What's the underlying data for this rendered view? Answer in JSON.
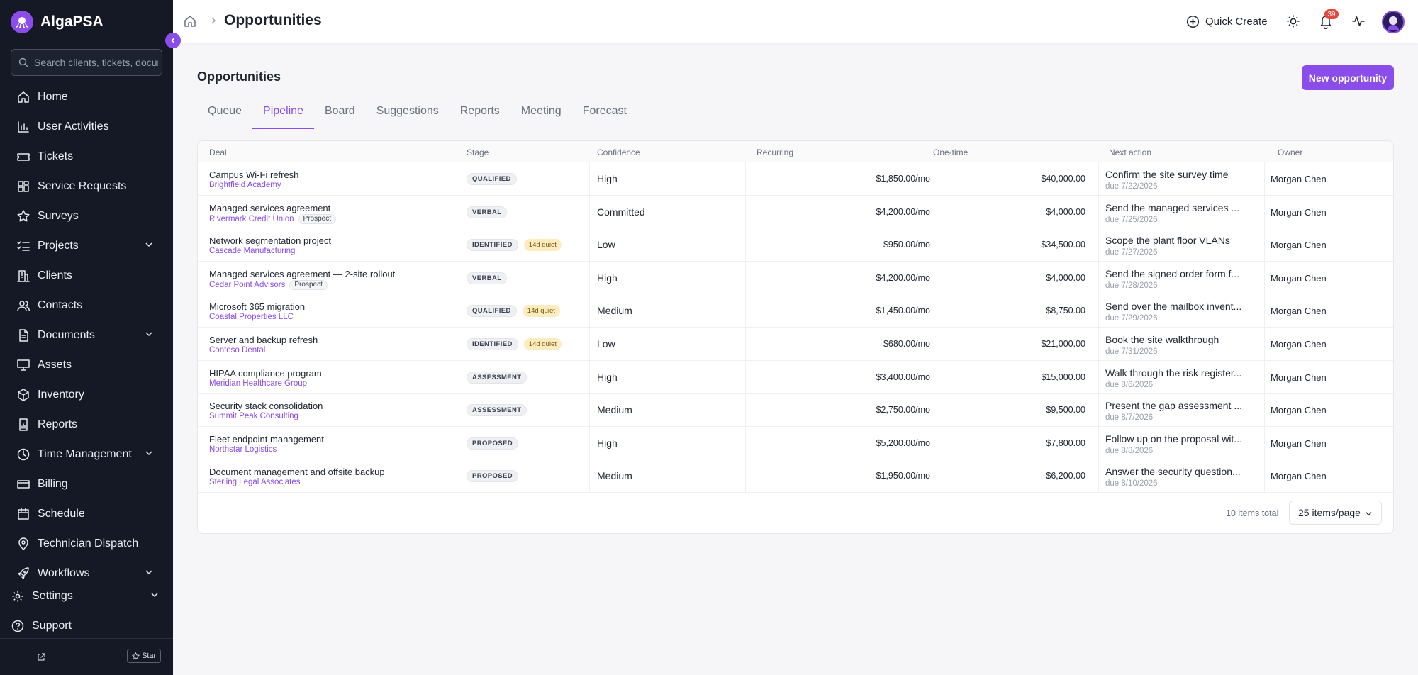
{
  "app": {
    "name": "AlgaPSA"
  },
  "sidebar": {
    "search_placeholder": "Search clients, tickets, documents",
    "items": [
      {
        "label": "Home",
        "icon": "home-icon",
        "expandable": false
      },
      {
        "label": "User Activities",
        "icon": "bar-chart-icon",
        "expandable": false
      },
      {
        "label": "Tickets",
        "icon": "ticket-icon",
        "expandable": false
      },
      {
        "label": "Service Requests",
        "icon": "layout-icon",
        "expandable": false
      },
      {
        "label": "Surveys",
        "icon": "star-icon",
        "expandable": false
      },
      {
        "label": "Projects",
        "icon": "list-checks-icon",
        "expandable": true
      },
      {
        "label": "Clients",
        "icon": "building-icon",
        "expandable": false
      },
      {
        "label": "Contacts",
        "icon": "users-icon",
        "expandable": false
      },
      {
        "label": "Documents",
        "icon": "file-icon",
        "expandable": true
      },
      {
        "label": "Assets",
        "icon": "monitor-icon",
        "expandable": false
      },
      {
        "label": "Inventory",
        "icon": "package-icon",
        "expandable": false
      },
      {
        "label": "Reports",
        "icon": "report-icon",
        "expandable": false
      },
      {
        "label": "Time Management",
        "icon": "clock-icon",
        "expandable": true
      },
      {
        "label": "Billing",
        "icon": "credit-card-icon",
        "expandable": false
      },
      {
        "label": "Schedule",
        "icon": "calendar-icon",
        "expandable": false
      },
      {
        "label": "Technician Dispatch",
        "icon": "map-pin-icon",
        "expandable": false
      },
      {
        "label": "Workflows",
        "icon": "rocket-icon",
        "expandable": true
      }
    ],
    "settings_label": "Settings",
    "support_label": "Support",
    "star_label": "Star"
  },
  "topbar": {
    "title": "Opportunities",
    "quick_create": "Quick Create",
    "notification_count": "39"
  },
  "main": {
    "title": "Opportunities",
    "new_button": "New opportunity",
    "tabs": [
      "Queue",
      "Pipeline",
      "Board",
      "Suggestions",
      "Reports",
      "Meeting",
      "Forecast"
    ],
    "active_tab": "Pipeline",
    "table": {
      "columns": [
        "Deal",
        "Stage",
        "Confidence",
        "Recurring",
        "One-time",
        "Next action",
        "Owner"
      ],
      "rows": [
        {
          "deal": "Campus Wi-Fi refresh",
          "client": "Brightfield Academy",
          "prospect": "",
          "stage": "QUALIFIED",
          "quiet": "",
          "confidence": "High",
          "recurring": "$1,850.00/mo",
          "onetime": "$40,000.00",
          "next": "Confirm the site survey time",
          "due": "due 7/22/2026",
          "owner": "Morgan Chen"
        },
        {
          "deal": "Managed services agreement",
          "client": "Rivermark Credit Union",
          "prospect": "Prospect",
          "stage": "VERBAL",
          "quiet": "",
          "confidence": "Committed",
          "recurring": "$4,200.00/mo",
          "onetime": "$4,000.00",
          "next": "Send the managed services ...",
          "due": "due 7/25/2026",
          "owner": "Morgan Chen"
        },
        {
          "deal": "Network segmentation project",
          "client": "Cascade Manufacturing",
          "prospect": "",
          "stage": "IDENTIFIED",
          "quiet": "14d quiet",
          "confidence": "Low",
          "recurring": "$950.00/mo",
          "onetime": "$34,500.00",
          "next": "Scope the plant floor VLANs",
          "due": "due 7/27/2026",
          "owner": "Morgan Chen"
        },
        {
          "deal": "Managed services agreement — 2-site rollout",
          "client": "Cedar Point Advisors",
          "prospect": "Prospect",
          "stage": "VERBAL",
          "quiet": "",
          "confidence": "High",
          "recurring": "$4,200.00/mo",
          "onetime": "$4,000.00",
          "next": "Send the signed order form f...",
          "due": "due 7/28/2026",
          "owner": "Morgan Chen"
        },
        {
          "deal": "Microsoft 365 migration",
          "client": "Coastal Properties LLC",
          "prospect": "",
          "stage": "QUALIFIED",
          "quiet": "14d quiet",
          "confidence": "Medium",
          "recurring": "$1,450.00/mo",
          "onetime": "$8,750.00",
          "next": "Send over the mailbox invent...",
          "due": "due 7/29/2026",
          "owner": "Morgan Chen"
        },
        {
          "deal": "Server and backup refresh",
          "client": "Contoso Dental",
          "prospect": "",
          "stage": "IDENTIFIED",
          "quiet": "14d quiet",
          "confidence": "Low",
          "recurring": "$680.00/mo",
          "onetime": "$21,000.00",
          "next": "Book the site walkthrough",
          "due": "due 7/31/2026",
          "owner": "Morgan Chen"
        },
        {
          "deal": "HIPAA compliance program",
          "client": "Meridian Healthcare Group",
          "prospect": "",
          "stage": "ASSESSMENT",
          "quiet": "",
          "confidence": "High",
          "recurring": "$3,400.00/mo",
          "onetime": "$15,000.00",
          "next": "Walk through the risk register...",
          "due": "due 8/6/2026",
          "owner": "Morgan Chen"
        },
        {
          "deal": "Security stack consolidation",
          "client": "Summit Peak Consulting",
          "prospect": "",
          "stage": "ASSESSMENT",
          "quiet": "",
          "confidence": "Medium",
          "recurring": "$2,750.00/mo",
          "onetime": "$9,500.00",
          "next": "Present the gap assessment ...",
          "due": "due 8/7/2026",
          "owner": "Morgan Chen"
        },
        {
          "deal": "Fleet endpoint management",
          "client": "Northstar Logistics",
          "prospect": "",
          "stage": "PROPOSED",
          "quiet": "",
          "confidence": "High",
          "recurring": "$5,200.00/mo",
          "onetime": "$7,800.00",
          "next": "Follow up on the proposal wit...",
          "due": "due 8/8/2026",
          "owner": "Morgan Chen"
        },
        {
          "deal": "Document management and offsite backup",
          "client": "Sterling Legal Associates",
          "prospect": "",
          "stage": "PROPOSED",
          "quiet": "",
          "confidence": "Medium",
          "recurring": "$1,950.00/mo",
          "onetime": "$6,200.00",
          "next": "Answer the security question...",
          "due": "due 8/10/2026",
          "owner": "Morgan Chen"
        }
      ],
      "total": "10 items total",
      "page_size": "25 items/page"
    }
  },
  "colors": {
    "accent": "#8a4dea",
    "sidebar_bg": "#141925",
    "badge_red": "#e5483d",
    "quiet_bg": "#fdecc0"
  }
}
